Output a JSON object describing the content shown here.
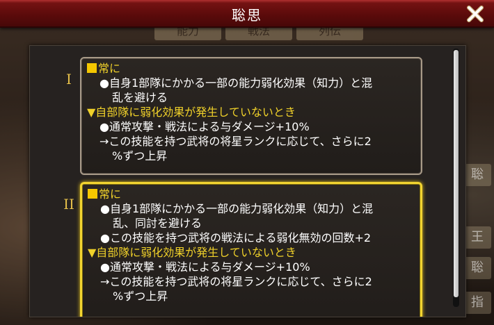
{
  "window": {
    "title": "聡思"
  },
  "background": {
    "tabs": [
      "能力",
      "戦法",
      "列伝"
    ],
    "side_buttons": [
      "聡",
      "王",
      "聡",
      "指"
    ]
  },
  "levels": [
    {
      "numeral": "I",
      "lines": [
        {
          "style": "head",
          "text": "常に"
        },
        {
          "style": "indent",
          "text": "●自身1部隊にかかる一部の能力弱化効果（知力）と混"
        },
        {
          "style": "indent2",
          "text": "乱を避ける"
        },
        {
          "style": "cond",
          "text": "▼自部隊に弱化効果が発生していないとき"
        },
        {
          "style": "indent",
          "text": "●通常攻撃・戦法による与ダメージ+10%"
        },
        {
          "style": "indent",
          "text": "→この技能を持つ武将の将星ランクに応じて、さらに2"
        },
        {
          "style": "indent2",
          "text": "%ずつ上昇"
        }
      ]
    },
    {
      "numeral": "II",
      "lines": [
        {
          "style": "head",
          "text": "常に"
        },
        {
          "style": "indent",
          "text": "●自身1部隊にかかる一部の能力弱化効果（知力）と混"
        },
        {
          "style": "indent2",
          "text": "乱、同討を避ける"
        },
        {
          "style": "indent",
          "text": "●この技能を持つ武将の戦法による弱化無効の回数+2"
        },
        {
          "style": "cond",
          "text": "▼自部隊に弱化効果が発生していないとき"
        },
        {
          "style": "indent",
          "text": "●通常攻撃・戦法による与ダメージ+10%"
        },
        {
          "style": "indent",
          "text": "→この技能を持つ武将の将星ランクに応じて、さらに2"
        },
        {
          "style": "indent2",
          "text": "%ずつ上昇"
        }
      ]
    }
  ],
  "icons": {
    "close": "close-x-icon",
    "head_marker": "yellow-square-icon"
  },
  "colors": {
    "title_bar": "#6a1010",
    "accent_gold": "#f0d12a",
    "selected_border": "#f2d431",
    "panel": "#262220"
  }
}
